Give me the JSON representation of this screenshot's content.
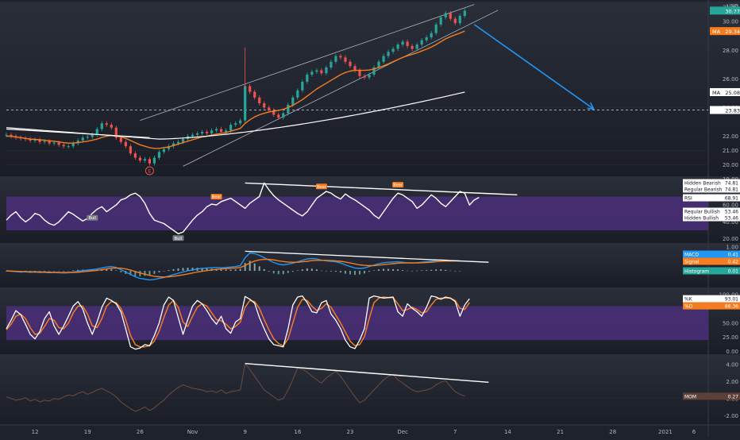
{
  "chart_data": [
    {
      "panel": "price",
      "type": "candlestick",
      "currency": "USD",
      "y_ticks": [
        "31.00",
        "30.00",
        "28.00",
        "26.00",
        "24.00",
        "22.00",
        "21.00",
        "20.00",
        "19.00"
      ],
      "ylim": [
        19.2,
        31.4
      ],
      "close": [
        22.1,
        22.0,
        21.9,
        21.85,
        21.8,
        21.7,
        21.75,
        21.6,
        21.65,
        21.5,
        21.55,
        21.4,
        21.3,
        21.3,
        21.5,
        21.7,
        21.9,
        21.95,
        22.1,
        22.5,
        22.9,
        22.8,
        22.6,
        21.9,
        21.6,
        21.3,
        20.8,
        20.5,
        20.3,
        20.4,
        20.1,
        20.5,
        20.9,
        21.1,
        21.3,
        21.5,
        21.6,
        21.8,
        22.0,
        22.1,
        22.2,
        22.3,
        22.2,
        22.4,
        22.5,
        22.3,
        22.4,
        22.8,
        22.9,
        23.1,
        25.5,
        25.1,
        24.7,
        24.3,
        24.0,
        23.8,
        23.5,
        23.3,
        23.6,
        24.2,
        24.7,
        25.2,
        25.8,
        26.3,
        26.5,
        26.6,
        26.4,
        26.8,
        27.2,
        27.6,
        27.5,
        27.2,
        26.9,
        26.6,
        26.2,
        26.1,
        26.3,
        26.8,
        27.2,
        27.6,
        27.9,
        28.1,
        28.4,
        28.6,
        28.3,
        28.1,
        28.4,
        28.7,
        28.9,
        29.2,
        29.8,
        30.3,
        30.6,
        30.2,
        29.9,
        30.4,
        30.77
      ],
      "candle_colors": {
        "up": "#26a69a",
        "down": "#ef5350"
      },
      "moving_averages": [
        {
          "name": "MA",
          "label": "MA",
          "value": "29.34",
          "color": "#f57c1f"
        },
        {
          "name": "MA",
          "label": "MA",
          "value": "25.08",
          "color": "#ffffff"
        }
      ],
      "ma_fast": [
        22.0,
        22.0,
        21.95,
        21.9,
        21.85,
        21.8,
        21.78,
        21.75,
        21.72,
        21.68,
        21.65,
        21.6,
        21.55,
        21.52,
        21.52,
        21.55,
        21.6,
        21.65,
        21.72,
        21.8,
        21.92,
        22.0,
        22.05,
        22.0,
        21.95,
        21.85,
        21.7,
        21.55,
        21.4,
        21.3,
        21.2,
        21.15,
        21.15,
        21.2,
        21.25,
        21.35,
        21.45,
        21.55,
        21.65,
        21.75,
        21.85,
        21.95,
        22.0,
        22.08,
        22.15,
        22.2,
        22.25,
        22.35,
        22.45,
        22.55,
        22.9,
        23.15,
        23.35,
        23.5,
        23.6,
        23.7,
        23.75,
        23.8,
        23.88,
        24.0,
        24.15,
        24.35,
        24.55,
        24.8,
        25.05,
        25.3,
        25.5,
        25.7,
        25.9,
        26.1,
        26.3,
        26.45,
        26.55,
        26.6,
        26.6,
        26.6,
        26.62,
        26.7,
        26.8,
        26.92,
        27.05,
        27.2,
        27.35,
        27.5,
        27.62,
        27.72,
        27.82,
        27.95,
        28.08,
        28.22,
        28.4,
        28.6,
        28.8,
        28.95,
        29.08,
        29.2,
        29.34
      ],
      "ma_slow_start": 23.3,
      "ma_slow_end": 25.08,
      "price_tags": [
        {
          "name": "last-price",
          "value": "30.77",
          "color": "#26a69a"
        },
        {
          "name": "ma-fast-tag",
          "value": "29.34",
          "color": "#f57c1f"
        },
        {
          "name": "ma-slow-tag",
          "value": "25.08",
          "color": "#ffffff"
        },
        {
          "name": "dashed-level",
          "value": "23.83",
          "color": "#ffffff"
        }
      ],
      "dashed_level": 23.83,
      "earnings_marker": "E",
      "annotations": {
        "channel_color": "#b2b5be",
        "arrow_color": "#2196f3"
      }
    },
    {
      "panel": "rsi",
      "type": "line",
      "y_ticks": [
        "80.00",
        "60.00",
        "40.00",
        "20.00"
      ],
      "ylim": [
        15,
        92
      ],
      "band": [
        30,
        70
      ],
      "values": [
        42,
        48,
        52,
        45,
        40,
        44,
        50,
        48,
        42,
        38,
        36,
        40,
        46,
        52,
        49,
        45,
        41,
        44,
        50,
        55,
        58,
        52,
        56,
        60,
        66,
        68,
        72,
        74,
        70,
        62,
        50,
        42,
        40,
        38,
        34,
        30,
        26,
        28,
        35,
        42,
        48,
        52,
        58,
        61,
        60,
        64,
        66,
        68,
        64,
        60,
        56,
        62,
        66,
        70,
        86,
        78,
        71,
        66,
        62,
        58,
        54,
        50,
        47,
        52,
        60,
        68,
        72,
        76,
        74,
        70,
        67,
        73,
        69,
        66,
        62,
        58,
        54,
        48,
        44,
        52,
        60,
        68,
        74,
        72,
        68,
        64,
        56,
        60,
        66,
        72,
        68,
        62,
        58,
        64,
        70,
        76,
        74,
        60,
        66,
        68.91
      ],
      "labels": [
        {
          "text": "Hidden Bearish",
          "value": "74.81"
        },
        {
          "text": "Regular Bearish",
          "value": "74.81"
        },
        {
          "text": "RSI",
          "value": "68.91"
        },
        {
          "text": "Regular Bullish",
          "value": "53.46"
        },
        {
          "text": "Hidden Bullish",
          "value": "53.46"
        }
      ],
      "markers": [
        {
          "text": "Bull",
          "index": 18
        },
        {
          "text": "Bull",
          "index": 36
        },
        {
          "text": "Bear",
          "index": 44
        },
        {
          "text": "Bear",
          "index": 66
        },
        {
          "text": "Bear",
          "index": 82
        }
      ],
      "line_color": "#ffffff",
      "band_color": "#4b2f7a"
    },
    {
      "panel": "macd",
      "type": "line",
      "y_ticks": [
        "1.00",
        "0.00"
      ],
      "ylim": [
        -0.7,
        1.1
      ],
      "macd": [
        0.0,
        -0.02,
        -0.03,
        -0.05,
        -0.04,
        -0.06,
        -0.05,
        -0.07,
        -0.06,
        -0.08,
        -0.07,
        -0.08,
        -0.09,
        -0.08,
        -0.05,
        -0.02,
        0.01,
        0.03,
        0.05,
        0.08,
        0.12,
        0.16,
        0.18,
        0.14,
        0.05,
        -0.05,
        -0.15,
        -0.25,
        -0.32,
        -0.35,
        -0.38,
        -0.36,
        -0.32,
        -0.28,
        -0.22,
        -0.16,
        -0.1,
        -0.05,
        0.0,
        0.04,
        0.08,
        0.1,
        0.12,
        0.13,
        0.14,
        0.13,
        0.14,
        0.16,
        0.18,
        0.22,
        0.55,
        0.75,
        0.72,
        0.65,
        0.55,
        0.45,
        0.35,
        0.28,
        0.25,
        0.28,
        0.32,
        0.38,
        0.44,
        0.5,
        0.52,
        0.5,
        0.45,
        0.42,
        0.4,
        0.38,
        0.33,
        0.25,
        0.18,
        0.12,
        0.1,
        0.12,
        0.18,
        0.24,
        0.3,
        0.34,
        0.36,
        0.37,
        0.38,
        0.36,
        0.34,
        0.33,
        0.34,
        0.36,
        0.38,
        0.4,
        0.44,
        0.46,
        0.45,
        0.42,
        0.42,
        0.41
      ],
      "signal": [
        0.0,
        -0.01,
        -0.02,
        -0.03,
        -0.03,
        -0.04,
        -0.04,
        -0.05,
        -0.05,
        -0.06,
        -0.06,
        -0.07,
        -0.07,
        -0.07,
        -0.07,
        -0.06,
        -0.04,
        -0.02,
        0.0,
        0.02,
        0.05,
        0.08,
        0.11,
        0.12,
        0.11,
        0.08,
        0.03,
        -0.03,
        -0.09,
        -0.14,
        -0.19,
        -0.23,
        -0.25,
        -0.26,
        -0.25,
        -0.23,
        -0.2,
        -0.17,
        -0.13,
        -0.09,
        -0.05,
        -0.02,
        0.01,
        0.04,
        0.06,
        0.08,
        0.09,
        0.11,
        0.12,
        0.14,
        0.22,
        0.33,
        0.41,
        0.46,
        0.48,
        0.48,
        0.46,
        0.42,
        0.39,
        0.37,
        0.36,
        0.36,
        0.38,
        0.4,
        0.43,
        0.44,
        0.44,
        0.44,
        0.43,
        0.42,
        0.4,
        0.37,
        0.33,
        0.29,
        0.25,
        0.23,
        0.22,
        0.22,
        0.24,
        0.26,
        0.28,
        0.3,
        0.32,
        0.33,
        0.33,
        0.33,
        0.33,
        0.34,
        0.35,
        0.36,
        0.38,
        0.4,
        0.41,
        0.41,
        0.42,
        0.42
      ],
      "labels": [
        {
          "text": "MACD",
          "value": "0.41",
          "color": "#2196f3"
        },
        {
          "text": "Signal",
          "value": "0.42",
          "color": "#f57c1f"
        },
        {
          "text": "Histogram",
          "value": "0.01",
          "color": "#26a69a"
        }
      ]
    },
    {
      "panel": "stochastic",
      "type": "line",
      "y_ticks": [
        "100.00",
        "50.00",
        "25.00",
        "0.00"
      ],
      "ylim": [
        -5,
        110
      ],
      "band": [
        20,
        80
      ],
      "k": [
        40,
        55,
        72,
        65,
        48,
        30,
        22,
        35,
        58,
        70,
        45,
        30,
        45,
        62,
        80,
        88,
        75,
        50,
        30,
        52,
        78,
        94,
        90,
        84,
        70,
        40,
        8,
        4,
        6,
        12,
        10,
        28,
        50,
        82,
        96,
        90,
        60,
        30,
        56,
        80,
        90,
        84,
        72,
        58,
        48,
        62,
        40,
        32,
        52,
        58,
        97,
        92,
        85,
        60,
        40,
        22,
        12,
        10,
        8,
        40,
        82,
        96,
        98,
        86,
        70,
        68,
        86,
        90,
        66,
        55,
        40,
        20,
        8,
        5,
        20,
        40,
        94,
        98,
        96,
        94,
        95,
        96,
        70,
        62,
        84,
        76,
        70,
        62,
        78,
        98,
        96,
        92,
        96,
        94,
        88,
        62,
        82,
        93.01
      ],
      "d": [
        38,
        48,
        62,
        66,
        58,
        42,
        30,
        32,
        44,
        58,
        55,
        42,
        40,
        50,
        68,
        80,
        80,
        66,
        45,
        42,
        58,
        80,
        88,
        86,
        76,
        56,
        28,
        12,
        8,
        8,
        10,
        18,
        36,
        60,
        82,
        90,
        78,
        52,
        44,
        62,
        78,
        84,
        80,
        68,
        56,
        54,
        48,
        40,
        44,
        52,
        78,
        90,
        88,
        76,
        56,
        38,
        22,
        14,
        10,
        22,
        50,
        78,
        92,
        90,
        80,
        72,
        76,
        84,
        78,
        64,
        50,
        34,
        18,
        10,
        12,
        26,
        58,
        86,
        94,
        96,
        95,
        95,
        84,
        72,
        74,
        78,
        74,
        68,
        70,
        82,
        92,
        94,
        94,
        94,
        90,
        76,
        74,
        86.36
      ],
      "labels": [
        {
          "text": "%K",
          "value": "93.01",
          "color": "#ffffff"
        },
        {
          "text": "%D",
          "value": "86.36",
          "color": "#f57c1f"
        }
      ],
      "band_color": "#4b2f7a"
    },
    {
      "panel": "momentum",
      "type": "line",
      "y_ticks": [
        "4.00",
        "2.00",
        "0.00",
        "-2.00"
      ],
      "ylim": [
        -3,
        5
      ],
      "values": [
        0.2,
        0.0,
        -0.2,
        -0.1,
        0.1,
        -0.3,
        -0.1,
        -0.4,
        -0.2,
        -0.3,
        0.0,
        -0.1,
        0.2,
        0.4,
        0.3,
        0.6,
        0.8,
        0.5,
        0.7,
        1.0,
        1.2,
        0.9,
        0.6,
        0.2,
        -0.4,
        -0.8,
        -1.2,
        -1.5,
        -1.3,
        -1.0,
        -1.4,
        -1.1,
        -0.6,
        -0.2,
        0.4,
        0.9,
        1.3,
        1.6,
        1.4,
        1.2,
        1.1,
        1.0,
        0.8,
        0.9,
        0.7,
        1.0,
        0.6,
        0.8,
        0.9,
        1.0,
        4.1,
        3.4,
        2.6,
        1.8,
        1.0,
        0.6,
        0.2,
        -0.2,
        0.0,
        1.0,
        2.2,
        3.6,
        3.4,
        3.1,
        2.6,
        2.2,
        1.8,
        2.4,
        2.8,
        3.2,
        2.6,
        1.8,
        1.0,
        0.2,
        -0.5,
        -0.2,
        0.4,
        1.0,
        1.6,
        2.2,
        2.6,
        2.8,
        2.2,
        1.8,
        1.4,
        1.0,
        0.8,
        0.9,
        1.0,
        1.2,
        1.6,
        1.9,
        2.1,
        1.4,
        0.8,
        0.5,
        0.27
      ],
      "labels": [
        {
          "text": "MOM",
          "value": "0.27",
          "color": "#5d4037"
        }
      ],
      "line_color": "#6d4c41"
    }
  ],
  "x_axis": {
    "labels": [
      {
        "text": "12",
        "index": 6
      },
      {
        "text": "19",
        "index": 17
      },
      {
        "text": "26",
        "index": 28
      },
      {
        "text": "Nov",
        "index": 39
      },
      {
        "text": "9",
        "index": 50
      },
      {
        "text": "16",
        "index": 61
      },
      {
        "text": "23",
        "index": 72
      },
      {
        "text": "Dec",
        "index": 83
      },
      {
        "text": "7",
        "index": 94
      },
      {
        "text": "14",
        "index": 105
      },
      {
        "text": "21",
        "index": 116
      },
      {
        "text": "28",
        "index": 127
      },
      {
        "text": "2021",
        "index": 138
      },
      {
        "text": "6",
        "index": 144
      }
    ]
  },
  "theme": {
    "background": "#1e222d",
    "grid": "#2a2e39",
    "axis_text": "#b2b5be",
    "divider": "#363a45"
  }
}
